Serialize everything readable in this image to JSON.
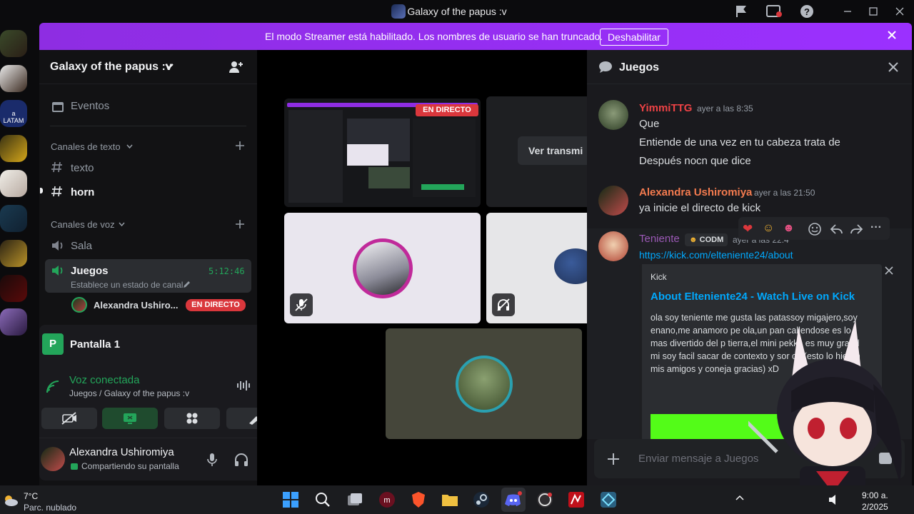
{
  "window": {
    "title": "Galaxy of the papus :v"
  },
  "banner": {
    "text": "El modo Streamer está habilitado. Los nombres de usuario se han truncado.",
    "button": "Deshabilitar"
  },
  "sidebar": {
    "guild_name": "Galaxy of the papus :v",
    "events_label": "Eventos",
    "text_category": "Canales de texto",
    "text_channels": [
      "texto",
      "horn"
    ],
    "voice_category": "Canales de voz",
    "voice_channels": [
      "Sala",
      "Juegos"
    ],
    "juegos_timer": "5:12:46",
    "juegos_status": "Establece un estado de canal",
    "voice_member": "Alexandra Ushiro...",
    "live_badge": "EN DIRECTO"
  },
  "stream_panel": {
    "title": "Pantalla 1"
  },
  "voice_panel": {
    "status": "Voz conectada",
    "location": "Juegos / Galaxy of the papus :v"
  },
  "user_panel": {
    "name": "Alexandra Ushiromiya",
    "status": "Compartiendo su pantalla"
  },
  "stage": {
    "live_badge": "EN DIRECTO",
    "watch_button": "Ver transmi"
  },
  "chat": {
    "channel": "Juegos",
    "messages": [
      {
        "author": "YimmiTTG",
        "author_color": "#ed4245",
        "timestamp": "ayer a las 8:35",
        "lines": [
          "Que",
          "Entiende de una vez en tu cabeza trata de",
          "Después nocn que dice"
        ]
      },
      {
        "author": "Alexandra Ushiromiya",
        "author_color": "#f47b4f",
        "timestamp": "ayer a las 21:50",
        "lines": [
          "ya inicie el directo de kick"
        ]
      },
      {
        "author": "Teniente",
        "author_color": "#9b59b6",
        "tag": "CODM",
        "timestamp": "ayer a las 22:4",
        "link": "https://kick.com/elteniente24/about",
        "embed": {
          "provider": "Kick",
          "title": "About Elteniente24 - Watch Live on Kick",
          "description": "ola soy teniente me gusta las patassoy migajero,soy enano,me anamoro pe ola,un pan callendose es lo mas divertido del p tierra,el mini pekka es muy grand mi soy facil sacar de contexto y sor ca (esto lo hieron mis amigos y coneja gracias) xD"
        }
      }
    ],
    "input_placeholder": "Enviar mensaje a Juegos"
  },
  "taskbar": {
    "weather_temp": "7°C",
    "weather_desc": "Parc. nublado",
    "clock_time": "9:00 a.",
    "clock_date": "2/2025"
  },
  "colors": {
    "banner": "#9b30ff",
    "live_red": "#da373c",
    "accent_green": "#23a55a",
    "link_blue": "#00a8fc"
  }
}
